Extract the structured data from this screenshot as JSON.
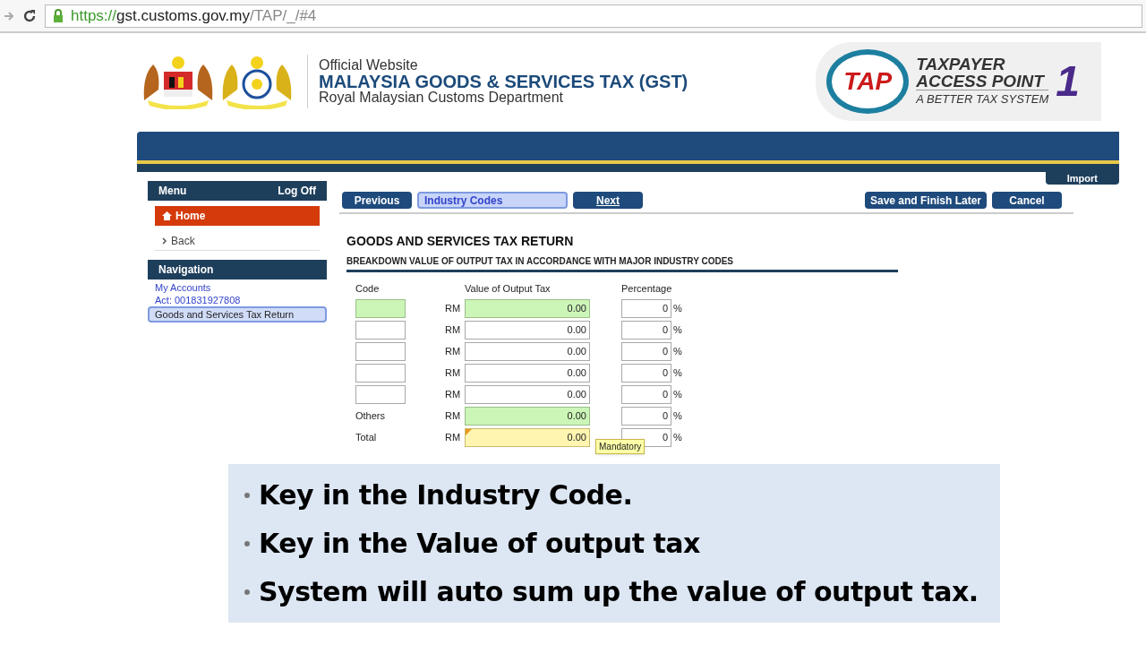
{
  "browser": {
    "url_scheme": "https://",
    "url_host": "gst.customs.gov.my",
    "url_path": "/TAP/_/#4"
  },
  "header": {
    "line1": "Official Website",
    "line2": "MALAYSIA GOODS & SERVICES TAX (GST)",
    "line3": "Royal Malaysian Customs Department",
    "tap_badge": "TAP",
    "tap_line1": "TAXPAYER",
    "tap_line2": "ACCESS POINT",
    "tap_line3": "A BETTER TAX SYSTEM",
    "tap_one": "1"
  },
  "banner": {
    "tab": "Import"
  },
  "sidebar": {
    "menu_title": "Menu",
    "logoff": "Log Off",
    "home": "Home",
    "back": "Back",
    "nav_title": "Navigation",
    "nav_items": [
      {
        "kind": "link",
        "label": "My Accounts",
        "selected": false
      },
      {
        "kind": "link",
        "label": "Act: 001831927808",
        "selected": false
      },
      {
        "kind": "item",
        "label": "Goods and Services Tax Return",
        "selected": true
      }
    ]
  },
  "toolbar": {
    "previous": "Previous",
    "step": "Industry Codes",
    "next": "Next",
    "save": "Save and Finish Later",
    "cancel": "Cancel"
  },
  "form": {
    "title": "GOODS AND SERVICES TAX RETURN",
    "subtitle": "BREAKDOWN VALUE OF OUTPUT TAX IN ACCORDANCE WITH MAJOR INDUSTRY CODES",
    "columns": [
      "Code",
      "Value of Output Tax",
      "Percentage"
    ],
    "rows": [
      {
        "kind": "code",
        "code_highlighted": true,
        "currency": "RM",
        "value": "0.00",
        "value_highlighted": true,
        "mandatory": false,
        "percentage": "0",
        "unit": "%"
      },
      {
        "kind": "code",
        "code_highlighted": false,
        "currency": "RM",
        "value": "0.00",
        "value_highlighted": false,
        "mandatory": false,
        "percentage": "0",
        "unit": "%"
      },
      {
        "kind": "code",
        "code_highlighted": false,
        "currency": "RM",
        "value": "0.00",
        "value_highlighted": false,
        "mandatory": false,
        "percentage": "0",
        "unit": "%"
      },
      {
        "kind": "code",
        "code_highlighted": false,
        "currency": "RM",
        "value": "0.00",
        "value_highlighted": false,
        "mandatory": false,
        "percentage": "0",
        "unit": "%"
      },
      {
        "kind": "code",
        "code_highlighted": false,
        "currency": "RM",
        "value": "0.00",
        "value_highlighted": false,
        "mandatory": false,
        "percentage": "0",
        "unit": "%"
      },
      {
        "kind": "label",
        "label": "Others",
        "currency": "RM",
        "value": "0.00",
        "value_highlighted": true,
        "mandatory": false,
        "percentage": "0",
        "unit": "%"
      },
      {
        "kind": "label",
        "label": "Total",
        "currency": "RM",
        "value": "0.00",
        "mandatory": true,
        "percentage": "0",
        "unit": "%",
        "tooltip": "Mandatory"
      }
    ]
  },
  "notes": [
    "Key in the Industry Code.",
    "Key in the Value of output tax",
    "System will auto sum up the value of output tax."
  ]
}
